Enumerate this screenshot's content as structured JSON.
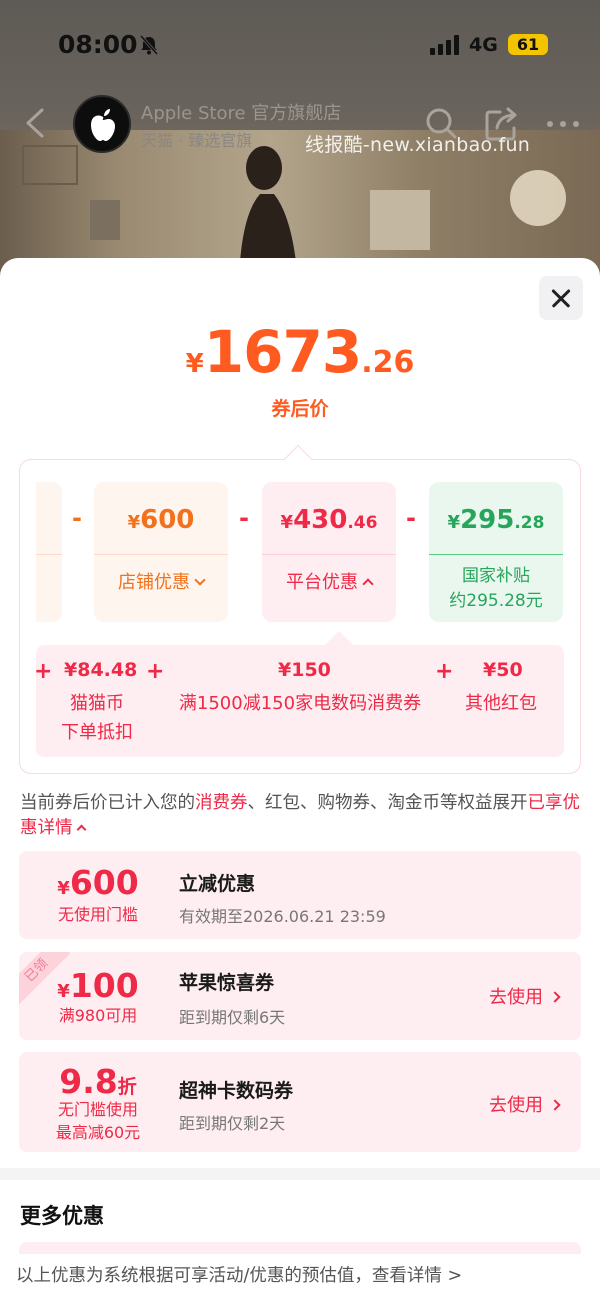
{
  "status_bar": {
    "time": "08:00",
    "network": "4G",
    "battery": "61"
  },
  "nav": {
    "shop_name": "Apple Store 官方旗舰店",
    "shop_sub": "天猫 · 臻选官旗"
  },
  "watermark": "线报酷-new.xianbao.fun",
  "price": {
    "currency": "¥",
    "integer": "1673",
    "decimal": ".26",
    "label": "券后价"
  },
  "breakdown": {
    "minus": "-",
    "plus": "+",
    "store": {
      "currency": "¥",
      "amount": "600",
      "label": "店铺优惠"
    },
    "platform": {
      "currency": "¥",
      "amount": "430",
      "decimal": ".46",
      "label": "平台优惠"
    },
    "national": {
      "currency": "¥",
      "amount": "295",
      "decimal": ".28",
      "label_line1": "国家补贴",
      "label_line2": "约295.28元"
    },
    "sub_items": [
      {
        "amount": "¥84.48",
        "desc_line1": "猫猫币",
        "desc_line2": "下单抵扣"
      },
      {
        "amount": "¥150",
        "desc_line1": "满1500减150家电数码消费券"
      },
      {
        "amount": "¥50",
        "desc_line1": "其他红包"
      }
    ]
  },
  "note": {
    "part1": "当前券后价已计入您的",
    "highlight1": "消费券",
    "part2": "、红包、购物券、淘金币等权益展开",
    "highlight2": "已享优惠详情"
  },
  "coupons": [
    {
      "currency": "¥",
      "amount": "600",
      "condition": "无使用门槛",
      "title": "立减优惠",
      "validity": "有效期至2026.06.21 23:59"
    },
    {
      "ribbon": "已领",
      "currency": "¥",
      "amount": "100",
      "condition": "满980可用",
      "title": "苹果惊喜券",
      "validity": "距到期仅剩6天",
      "action": "去使用"
    },
    {
      "amount": "9.8",
      "unit": "折",
      "condition_line1": "无门槛使用",
      "condition_line2": "最高减60元",
      "title": "超神卡数码券",
      "validity": "距到期仅剩2天",
      "action": "去使用"
    }
  ],
  "more": {
    "title": "更多优惠"
  },
  "footer": {
    "text": "以上优惠为系统根据可享活动/优惠的预估值，",
    "link": "查看详情 >"
  },
  "colors": {
    "accent_orange": "#ff5a1f",
    "accent_red": "#ee2a48",
    "accent_green": "#27a55a",
    "battery": "#f5c400"
  }
}
